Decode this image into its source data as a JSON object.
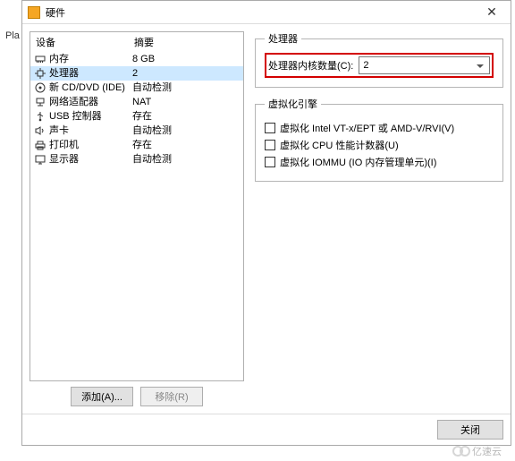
{
  "bg_text": "Pla",
  "dialog": {
    "title": "硬件",
    "close_x": "✕"
  },
  "hw_list": {
    "header_device": "设备",
    "header_summary": "摘要",
    "rows": [
      {
        "icon": "memory-icon",
        "device": "内存",
        "summary": "8 GB",
        "selected": false
      },
      {
        "icon": "cpu-icon",
        "device": "处理器",
        "summary": "2",
        "selected": true
      },
      {
        "icon": "disc-icon",
        "device": "新 CD/DVD (IDE)",
        "summary": "自动检测",
        "selected": false
      },
      {
        "icon": "network-icon",
        "device": "网络适配器",
        "summary": "NAT",
        "selected": false
      },
      {
        "icon": "usb-icon",
        "device": "USB 控制器",
        "summary": "存在",
        "selected": false
      },
      {
        "icon": "sound-icon",
        "device": "声卡",
        "summary": "自动检测",
        "selected": false
      },
      {
        "icon": "printer-icon",
        "device": "打印机",
        "summary": "存在",
        "selected": false
      },
      {
        "icon": "display-icon",
        "device": "显示器",
        "summary": "自动检测",
        "selected": false
      }
    ]
  },
  "buttons": {
    "add": "添加(A)...",
    "remove": "移除(R)"
  },
  "right": {
    "processors_legend": "处理器",
    "cores_label": "处理器内核数量(C):",
    "cores_value": "2",
    "virt_legend": "虚拟化引擎",
    "virt_vt": "虚拟化 Intel VT-x/EPT 或 AMD-V/RVI(V)",
    "virt_cpu": "虚拟化 CPU 性能计数器(U)",
    "virt_iommu": "虚拟化 IOMMU (IO 内存管理单元)(I)"
  },
  "footer": {
    "close": "关闭"
  },
  "watermark": "亿速云"
}
